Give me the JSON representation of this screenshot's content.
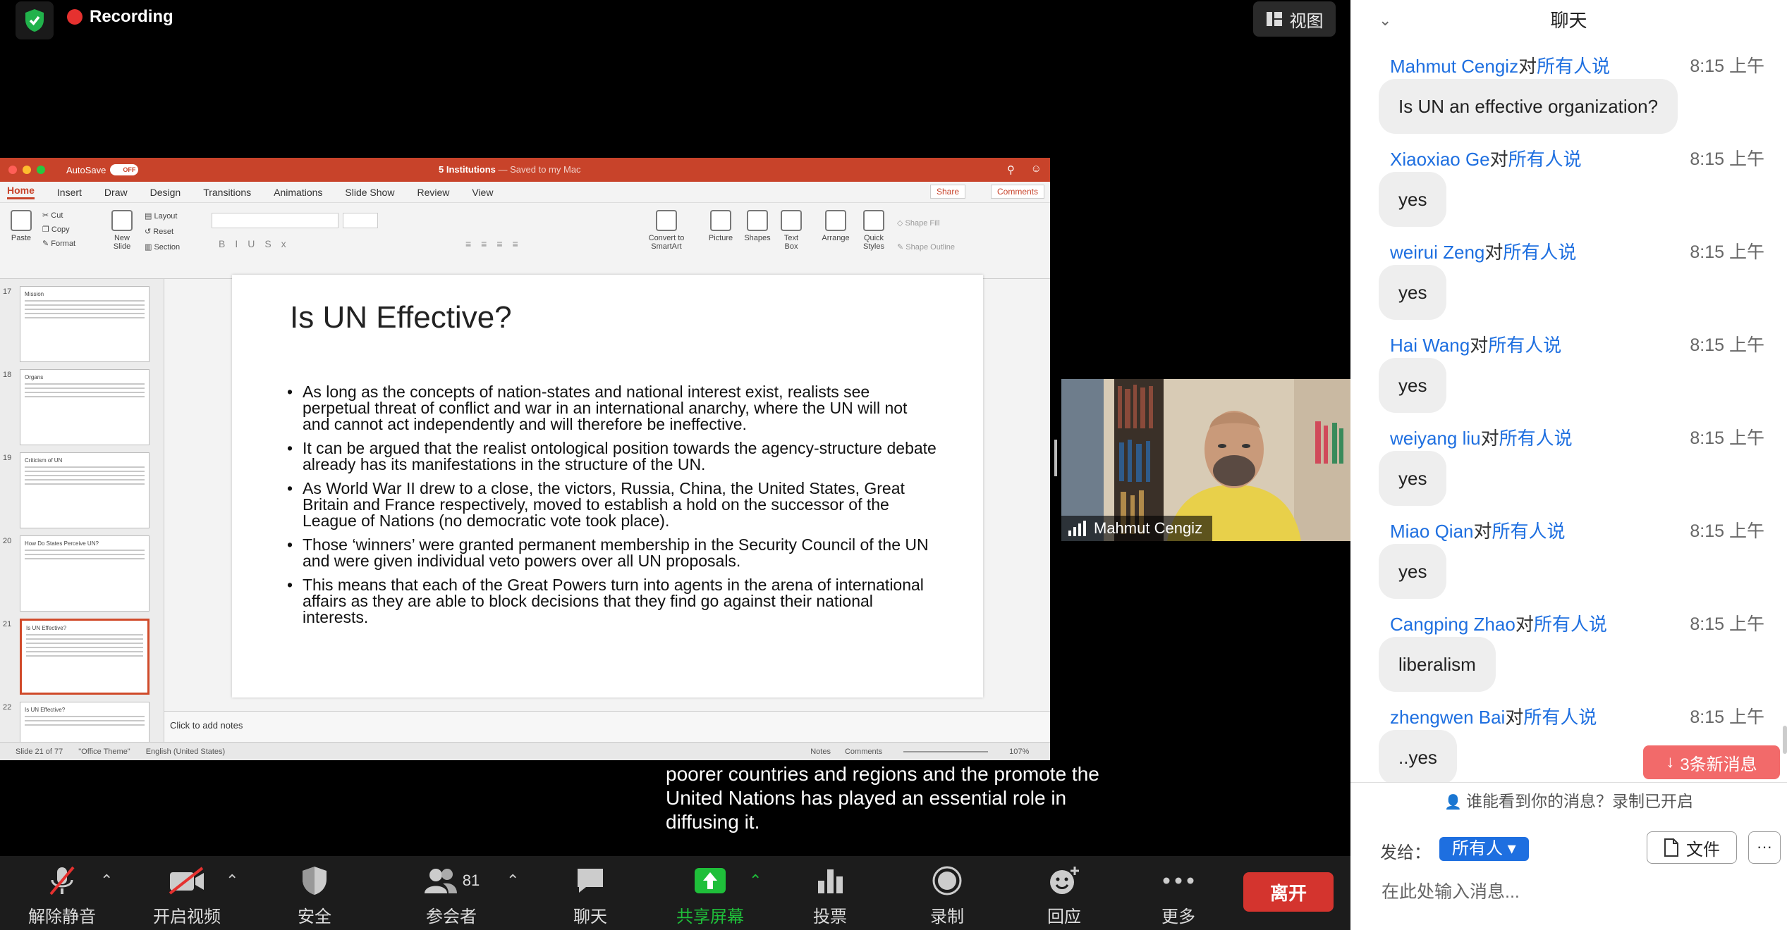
{
  "recording_label": "Recording",
  "view_label": "视图",
  "ppt": {
    "autosave": "AutoSave",
    "autosave_state": "OFF",
    "doc_title": "5 Institutions",
    "doc_saved": "— Saved to my Mac",
    "menu": [
      "Home",
      "Insert",
      "Draw",
      "Design",
      "Transitions",
      "Animations",
      "Slide Show",
      "Review",
      "View"
    ],
    "share": "Share",
    "comments": "Comments",
    "ribbon": {
      "paste": "Paste",
      "cut": "Cut",
      "copy": "Copy",
      "format": "Format",
      "new_slide": "New Slide",
      "layout": "Layout",
      "reset": "Reset",
      "section": "Section",
      "convert": "Convert to SmartArt",
      "picture": "Picture",
      "shapes": "Shapes",
      "textbox": "Text Box",
      "arrange": "Arrange",
      "quick_styles": "Quick Styles",
      "shape_fill": "Shape Fill",
      "shape_outline": "Shape Outline"
    },
    "thumbnails": [
      {
        "num": "17",
        "title": "Mission"
      },
      {
        "num": "18",
        "title": "Organs"
      },
      {
        "num": "19",
        "title": "Criticism of UN"
      },
      {
        "num": "20",
        "title": "How Do States Perceive UN?"
      },
      {
        "num": "21",
        "title": "Is UN Effective?"
      },
      {
        "num": "22",
        "title": "Is UN Effective?"
      }
    ],
    "slide": {
      "title": "Is UN Effective?",
      "bullets": [
        "As long as the concepts of nation-states and national interest exist, realists see perpetual threat of conflict and war in an international anarchy, where the UN will not and cannot act independently and will therefore be ineffective.",
        "It can be argued that the realist ontological position towards the agency-structure debate already has its manifestations in the structure of the UN.",
        "As World War II drew to a close, the victors, Russia, China, the United States, Great Britain and France respectively, moved to establish a hold on the successor of the League of Nations (no democratic vote took place).",
        "Those ‘winners’ were granted permanent membership in the Security Council of the UN and were given individual veto powers over all UN proposals.",
        "This means that each of the Great Powers turn into agents in the arena of international affairs as they are able to block decisions that they find go against their national interests."
      ]
    },
    "notes_placeholder": "Click to add notes",
    "status": {
      "slide": "Slide 21 of 77",
      "theme": "\"Office Theme\"",
      "lang": "English (United States)",
      "notes": "Notes",
      "comments": "Comments",
      "zoom": "107%"
    }
  },
  "video": {
    "name": "Mahmut Cengiz"
  },
  "caption": "poorer countries and regions and the promote the United Nations has played an essential role in diffusing it.",
  "toolbar": {
    "unmute": "解除静音",
    "start_video": "开启视频",
    "security": "安全",
    "participants": "参会者",
    "participants_count": "81",
    "chat": "聊天",
    "share": "共享屏幕",
    "polls": "投票",
    "record": "录制",
    "reactions": "回应",
    "more": "更多",
    "leave": "离开"
  },
  "chat": {
    "title": "聊天",
    "to_label": "对",
    "everyone_said": "所有人说",
    "messages": [
      {
        "sender": "Mahmut Cengiz",
        "time": "8:15 上午",
        "text": "Is UN an effective organization?"
      },
      {
        "sender": "Xiaoxiao Ge",
        "time": "8:15 上午",
        "text": "yes"
      },
      {
        "sender": "weirui Zeng",
        "time": "8:15 上午",
        "text": "yes"
      },
      {
        "sender": "Hai Wang",
        "time": "8:15 上午",
        "text": "yes"
      },
      {
        "sender": "weiyang liu",
        "time": "8:15 上午",
        "text": "yes"
      },
      {
        "sender": "Miao Qian",
        "time": "8:15 上午",
        "text": "yes"
      },
      {
        "sender": "Cangping Zhao",
        "time": "8:15 上午",
        "text": "liberalism"
      },
      {
        "sender": "zhengwen Bai",
        "time": "8:15 上午",
        "text": "..yes"
      }
    ],
    "new_messages": "3条新消息",
    "who_can_see": "谁能看到你的消息？录制已开启",
    "send_to": "发给：",
    "audience": "所有人",
    "file": "文件",
    "input_placeholder": "在此处输入消息..."
  },
  "colors": {
    "accent": "#1e6fe0",
    "leave": "#d4342e",
    "share_green": "#1fbf3a",
    "ppt_red": "#c8432a"
  }
}
